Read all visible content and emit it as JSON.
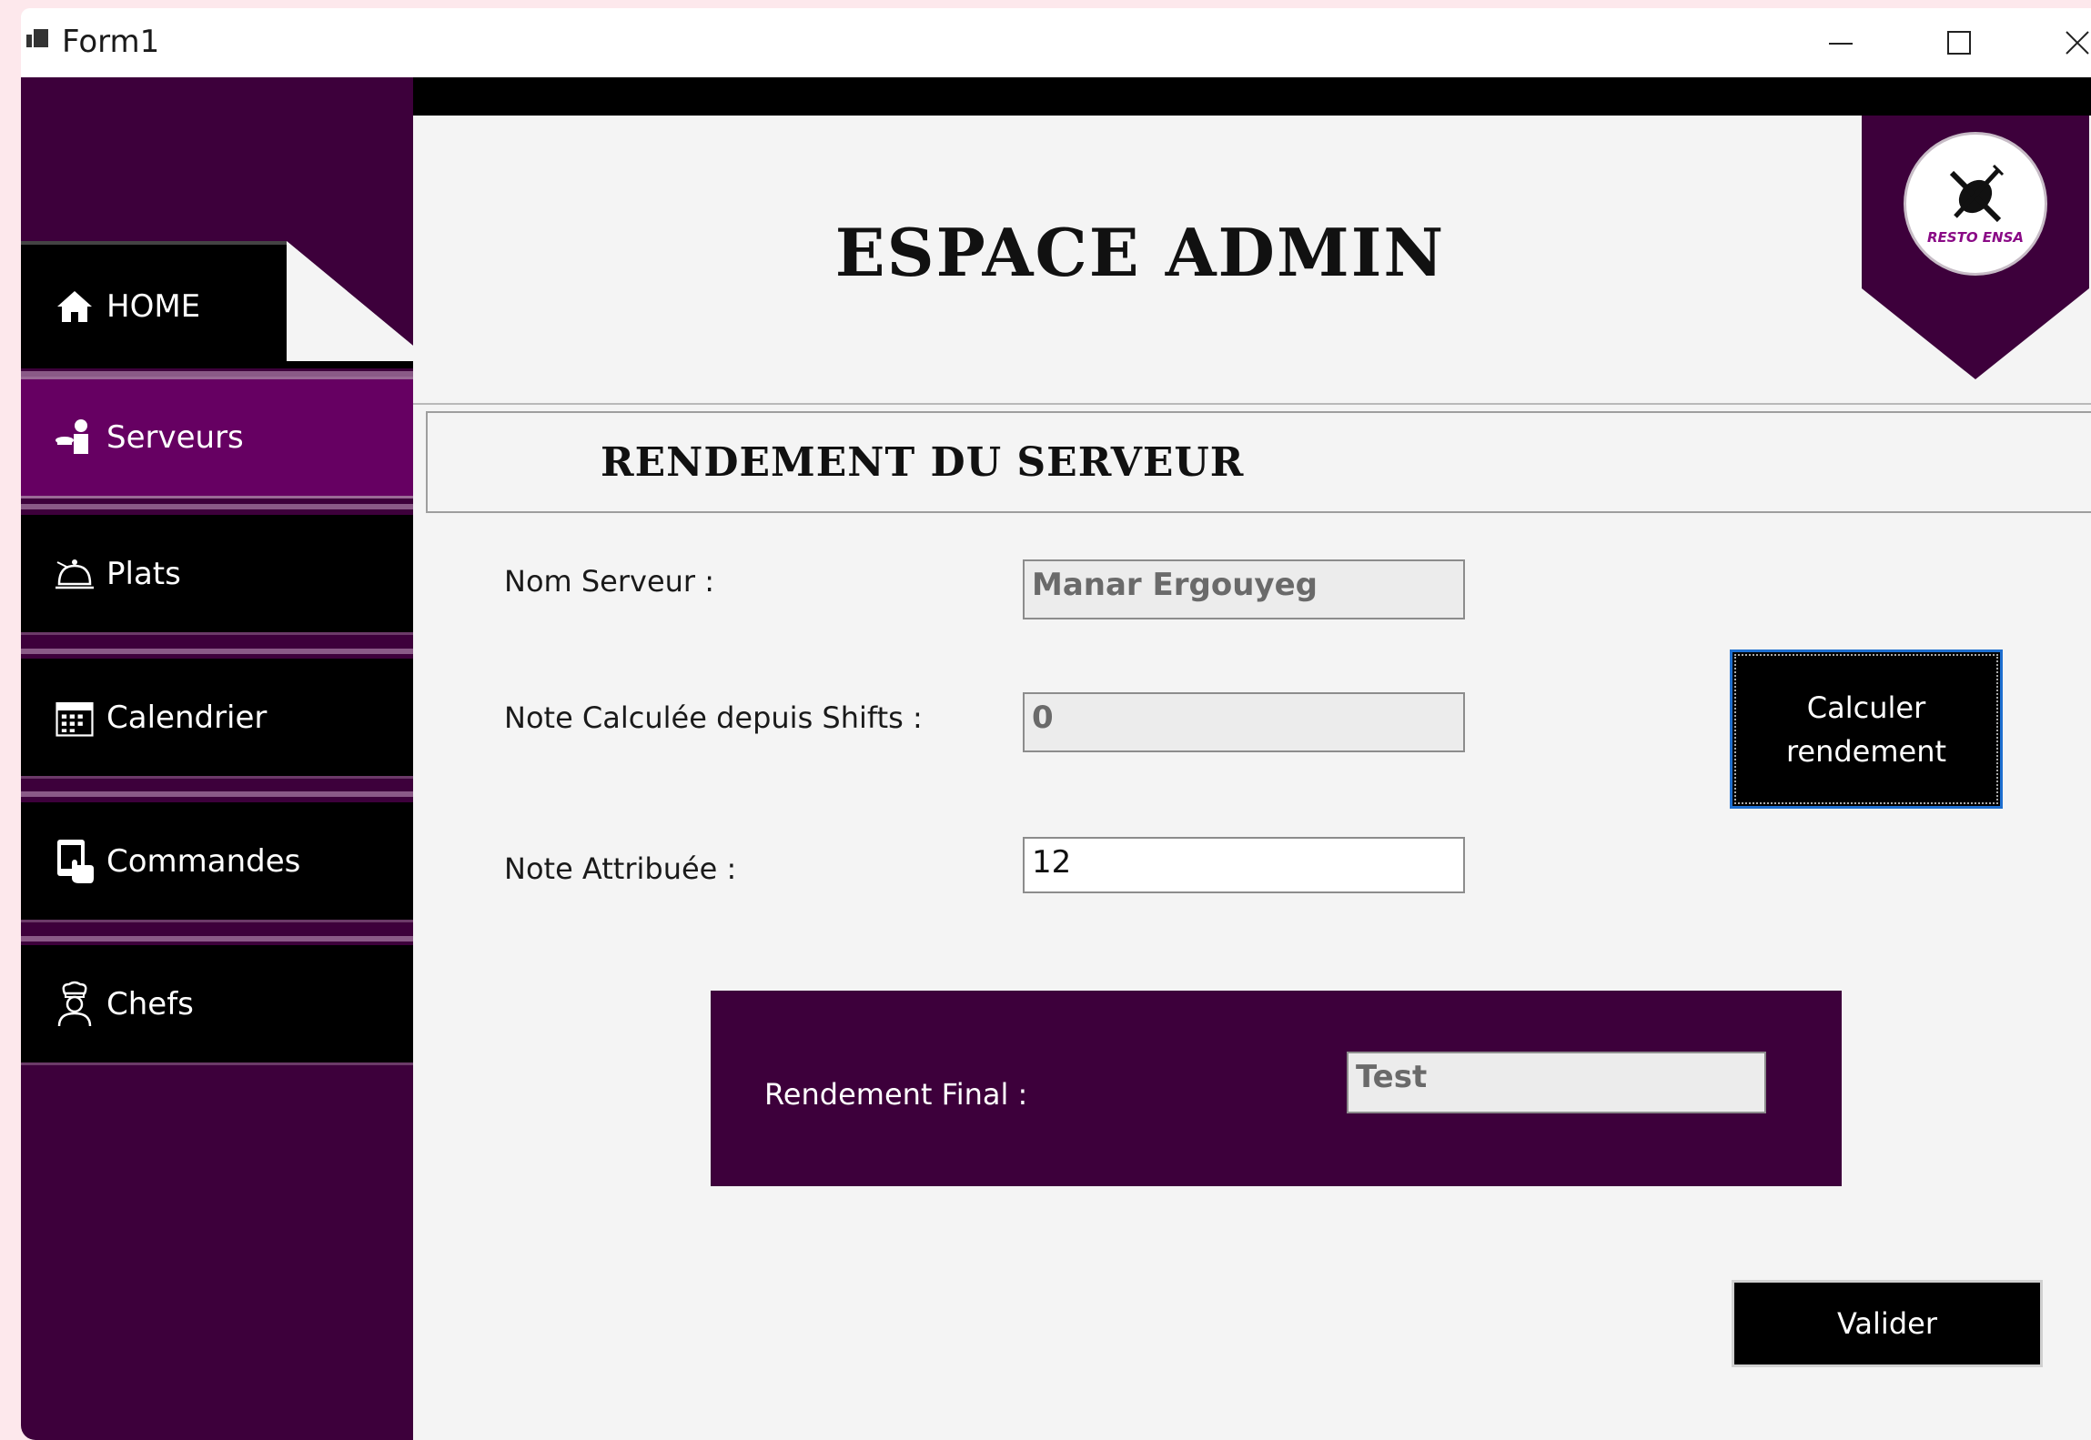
{
  "window": {
    "title": "Form1"
  },
  "sidebar": {
    "items": [
      {
        "label": "HOME",
        "icon": "home-icon"
      },
      {
        "label": "Serveurs",
        "icon": "waiter-icon"
      },
      {
        "label": "Plats",
        "icon": "cloche-icon"
      },
      {
        "label": "Calendrier",
        "icon": "calendar-icon"
      },
      {
        "label": "Commandes",
        "icon": "tablet-order-icon"
      },
      {
        "label": "Chefs",
        "icon": "chef-icon"
      }
    ],
    "active": "Serveurs"
  },
  "header": {
    "title": "ESPACE ADMIN",
    "logo_text": "RESTO ENSA"
  },
  "section": {
    "title": "RENDEMENT DU SERVEUR"
  },
  "form": {
    "nom_label": "Nom Serveur :",
    "nom_value": "Manar Ergouyeg",
    "note_calc_label": "Note Calculée depuis Shifts :",
    "note_calc_value": "0",
    "note_attr_label": "Note Attribuée :",
    "note_attr_value": "12",
    "calc_button": [
      "Calculer",
      "rendement"
    ],
    "rendement_label": "Rendement Final :",
    "rendement_value": "Test",
    "valider_button": "Valider"
  },
  "colors": {
    "sidebar": "#3d003b",
    "active": "#660062",
    "panel": "#3d003b"
  }
}
